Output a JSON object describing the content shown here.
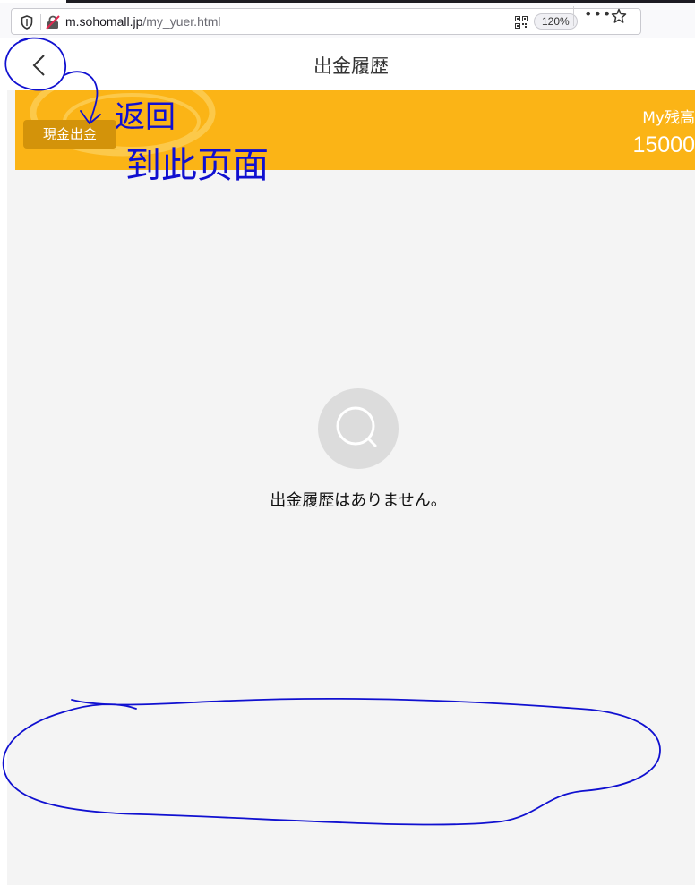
{
  "browser": {
    "url_domain": "m.sohomall.jp",
    "url_path": "/my_yuer.html",
    "zoom": "120%",
    "more_label": "•••"
  },
  "header": {
    "title": "出金履歴"
  },
  "balance": {
    "withdraw_button": "現金出金",
    "label": "My残高",
    "value": "15000"
  },
  "empty_state": {
    "icon": "search-icon",
    "message": "出金履歴はありません。"
  },
  "annotation": {
    "handwritten_note_line1": "返回",
    "handwritten_note_line2": "到此页面",
    "ink_color": "#1010d0"
  },
  "colors": {
    "banner": "#fbb416",
    "withdraw_button": "#d3930a",
    "background": "#f4f4f4"
  }
}
